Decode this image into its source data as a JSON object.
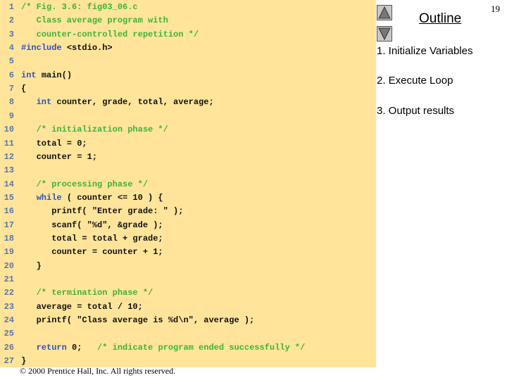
{
  "page_number": "19",
  "outline": {
    "title": "Outline",
    "items": [
      "1.  Initialize Variables",
      "2.  Execute Loop",
      "3.  Output results"
    ],
    "up_icon": "triangle-up-icon",
    "down_icon": "triangle-down-icon"
  },
  "copyright": "© 2000 Prentice Hall, Inc.  All rights reserved.",
  "colors": {
    "panel": "#ffe49a",
    "comment": "#3cb43c",
    "keyword": "#3050c0",
    "line_number": "#5a78a8"
  },
  "code": [
    [
      [
        "c",
        "/* Fig. 3.6: fig03_06.c"
      ]
    ],
    [
      [
        "c",
        "   Class average program with"
      ]
    ],
    [
      [
        "c",
        "   counter-controlled repetition */"
      ]
    ],
    [
      [
        "k",
        "#include "
      ],
      [
        "t",
        "<stdio.h>"
      ]
    ],
    [],
    [
      [
        "k",
        "int "
      ],
      [
        "t",
        "main()"
      ]
    ],
    [
      [
        "t",
        "{"
      ]
    ],
    [
      [
        "k",
        "   int "
      ],
      [
        "t",
        "counter, grade, total, average;"
      ]
    ],
    [],
    [
      [
        "c",
        "   /* initialization phase */"
      ]
    ],
    [
      [
        "t",
        "   total = 0;"
      ]
    ],
    [
      [
        "t",
        "   counter = 1;"
      ]
    ],
    [],
    [
      [
        "c",
        "   /* processing phase */"
      ]
    ],
    [
      [
        "k",
        "   while "
      ],
      [
        "t",
        "( counter <= 10 ) {"
      ]
    ],
    [
      [
        "t",
        "      printf( \"Enter grade: \" );"
      ]
    ],
    [
      [
        "t",
        "      scanf( \"%d\", &grade );"
      ]
    ],
    [
      [
        "t",
        "      total = total + grade;"
      ]
    ],
    [
      [
        "t",
        "      counter = counter + 1;"
      ]
    ],
    [
      [
        "t",
        "   }"
      ]
    ],
    [],
    [
      [
        "c",
        "   /* termination phase */"
      ]
    ],
    [
      [
        "t",
        "   average = total / 10;"
      ]
    ],
    [
      [
        "t",
        "   printf( \"Class average is %d\\n\", average );"
      ]
    ],
    [],
    [
      [
        "k",
        "   return "
      ],
      [
        "t",
        "0;   "
      ],
      [
        "c",
        "/* indicate program ended successfully */"
      ]
    ],
    [
      [
        "t",
        "}"
      ]
    ]
  ]
}
